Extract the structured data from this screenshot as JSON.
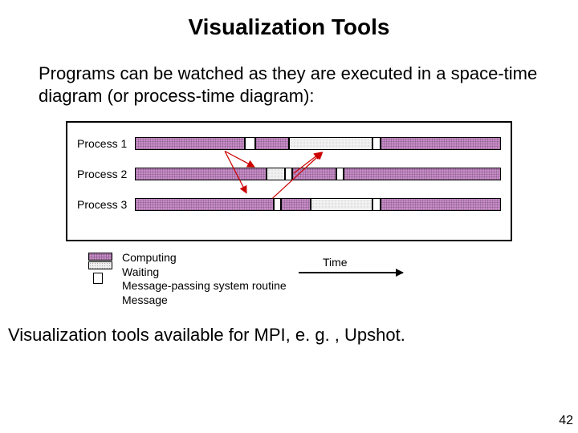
{
  "title": "Visualization Tools",
  "intro": "Programs can be watched as they are executed in a space-time diagram (or process-time diagram):",
  "processes": {
    "p1": "Process 1",
    "p2": "Process 2",
    "p3": "Process 3"
  },
  "legend": {
    "computing": "Computing",
    "waiting": "Waiting",
    "system": "Message-passing system routine",
    "message": "Message",
    "time": "Time"
  },
  "footer": "Visualization tools available for MPI, e. g. , Upshot.",
  "page": "42",
  "chart_data": {
    "type": "bar",
    "title": "Space-time diagram",
    "xlabel": "Time",
    "ylabel": "Process",
    "categories": [
      "Process 1",
      "Process 2",
      "Process 3"
    ],
    "segment_types": [
      "compute",
      "wait",
      "system_routine"
    ],
    "series": [
      {
        "name": "Process 1",
        "segments": [
          {
            "type": "compute",
            "start": 0,
            "end": 30
          },
          {
            "type": "system_routine",
            "start": 30,
            "end": 33
          },
          {
            "type": "compute",
            "start": 33,
            "end": 42
          },
          {
            "type": "wait",
            "start": 42,
            "end": 65
          },
          {
            "type": "system_routine",
            "start": 65,
            "end": 67
          },
          {
            "type": "compute",
            "start": 67,
            "end": 100
          }
        ]
      },
      {
        "name": "Process 2",
        "segments": [
          {
            "type": "compute",
            "start": 0,
            "end": 36
          },
          {
            "type": "wait",
            "start": 36,
            "end": 41
          },
          {
            "type": "system_routine",
            "start": 41,
            "end": 43
          },
          {
            "type": "compute",
            "start": 43,
            "end": 55
          },
          {
            "type": "system_routine",
            "start": 55,
            "end": 57
          },
          {
            "type": "compute",
            "start": 57,
            "end": 100
          }
        ]
      },
      {
        "name": "Process 3",
        "segments": [
          {
            "type": "compute",
            "start": 0,
            "end": 38
          },
          {
            "type": "system_routine",
            "start": 38,
            "end": 40
          },
          {
            "type": "compute",
            "start": 40,
            "end": 48
          },
          {
            "type": "wait",
            "start": 48,
            "end": 65
          },
          {
            "type": "system_routine",
            "start": 65,
            "end": 67
          },
          {
            "type": "compute",
            "start": 67,
            "end": 100
          }
        ]
      }
    ],
    "messages": [
      {
        "from": "Process 1",
        "t_from": 31,
        "to": "Process 2",
        "t_to": 42
      },
      {
        "from": "Process 1",
        "t_from": 31,
        "to": "Process 3",
        "t_to": 39
      },
      {
        "from": "Process 2",
        "t_from": 56,
        "to": "Process 1",
        "t_to": 66
      },
      {
        "from": "Process 3",
        "t_from": 48,
        "to": "Process 1",
        "t_to": 66
      }
    ]
  }
}
